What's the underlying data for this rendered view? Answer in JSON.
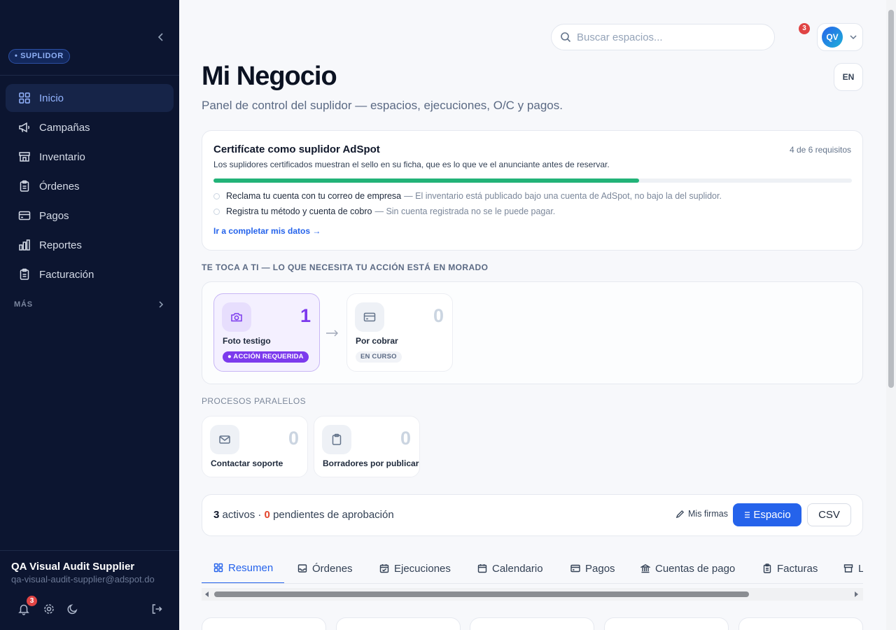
{
  "sidebar": {
    "role": "• SUPLIDOR",
    "items": [
      {
        "label": "Inicio",
        "icon": "grid-icon",
        "active": true
      },
      {
        "label": "Campañas",
        "icon": "megaphone-icon"
      },
      {
        "label": "Inventario",
        "icon": "store-icon"
      },
      {
        "label": "Órdenes",
        "icon": "clipboard-icon"
      },
      {
        "label": "Pagos",
        "icon": "card-icon"
      },
      {
        "label": "Reportes",
        "icon": "bar-chart-icon"
      },
      {
        "label": "Facturación",
        "icon": "clipboard-icon"
      }
    ],
    "more_label": "MÁS",
    "user_name": "QA Visual Audit Supplier",
    "user_email": "qa-visual-audit-supplier@adspot.do",
    "notification_count": "3"
  },
  "header": {
    "search_placeholder": "Buscar espacios...",
    "notification_count": "3",
    "avatar_initials": "QV",
    "lang": "EN"
  },
  "page": {
    "title": "Mi Negocio",
    "subtitle": "Panel de control del suplidor — espacios, ejecuciones, O/C y pagos."
  },
  "certification": {
    "title": "Certifícate como suplidor AdSpot",
    "requirements": "4 de 6 requisitos",
    "progress": 0.667,
    "description": "Los suplidores certificados muestran el sello en su ficha, que es lo que ve el anunciante antes de reservar.",
    "items": [
      {
        "title": "Reclama tu cuenta con tu correo de empresa",
        "note": "— El inventario está publicado bajo una cuenta de AdSpot, no bajo la del suplidor."
      },
      {
        "title": "Registra tu método y cuenta de cobro",
        "note": "— Sin cuenta registrada no se le puede pagar."
      }
    ],
    "link": "Ir a completar mis datos →"
  },
  "action_section": {
    "label": "TE TOCA A TI — LO QUE NECESITA TU ACCIÓN ESTÁ EN MORADO",
    "steps": [
      {
        "label": "Foto testigo",
        "count": "1",
        "badge": "● ACCIÓN REQUERIDA",
        "icon": "camera-icon"
      },
      {
        "label": "Por cobrar",
        "count": "0",
        "badge": "EN CURSO",
        "icon": "card-icon"
      }
    ]
  },
  "parallel_section": {
    "label": "PROCESOS PARALELOS",
    "items": [
      {
        "label": "Contactar soporte",
        "count": "0",
        "icon": "mail-icon"
      },
      {
        "label": "Borradores por publicar",
        "count": "0",
        "icon": "clipboard-icon"
      }
    ]
  },
  "stats": {
    "active_count": "3",
    "active_label": "activos ·",
    "pending_count": "0",
    "pending_label": "pendientes de aprobación",
    "firmas_label": "Mis firmas",
    "espacio_label": "Espacio",
    "csv_label": "CSV"
  },
  "tabs": [
    {
      "label": "Resumen",
      "icon": "grid-icon",
      "active": true
    },
    {
      "label": "Órdenes",
      "icon": "inbox-icon"
    },
    {
      "label": "Ejecuciones",
      "icon": "calendar-check-icon"
    },
    {
      "label": "Calendario",
      "icon": "calendar-icon"
    },
    {
      "label": "Pagos",
      "icon": "card-icon"
    },
    {
      "label": "Cuentas de pago",
      "icon": "bank-icon"
    },
    {
      "label": "Facturas",
      "icon": "clipboard-icon"
    },
    {
      "label": "L",
      "icon": "store-icon"
    }
  ],
  "colors": {
    "accent": "#2563eb",
    "action": "#7c3aed",
    "progress": "#22b378",
    "sidebar": "#0c1530",
    "warning": "#e3452c"
  }
}
